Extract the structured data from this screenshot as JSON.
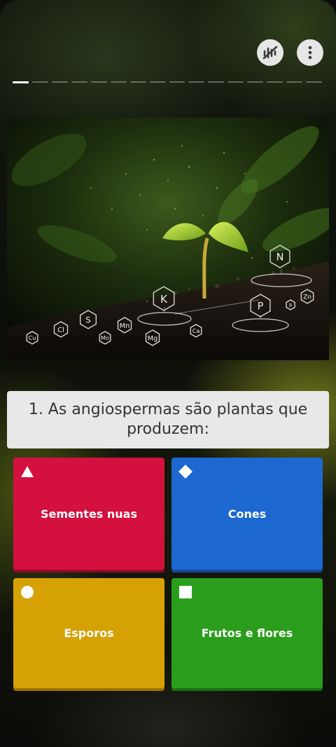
{
  "header": {
    "sound_icon": "sound-waves-muted-icon",
    "menu_icon": "more-vertical-icon",
    "progress": {
      "total": 16,
      "current": 1
    }
  },
  "hero": {
    "description_icon": "seedling-nutrients-image",
    "elements": [
      "N",
      "K",
      "P",
      "S",
      "Cl",
      "Cu",
      "Mn",
      "Mo",
      "Mg",
      "Ca",
      "B",
      "Zn"
    ]
  },
  "question": {
    "text": "1. As angiospermas são plantas que produzem:"
  },
  "answers": [
    {
      "label": "Sementes nuas",
      "shape": "triangle",
      "color": "#d4103f"
    },
    {
      "label": "Cones",
      "shape": "diamond",
      "color": "#1d67d0"
    },
    {
      "label": "Esporos",
      "shape": "circle",
      "color": "#d5a104"
    },
    {
      "label": "Frutos e flores",
      "shape": "square",
      "color": "#2a9e1c"
    }
  ]
}
